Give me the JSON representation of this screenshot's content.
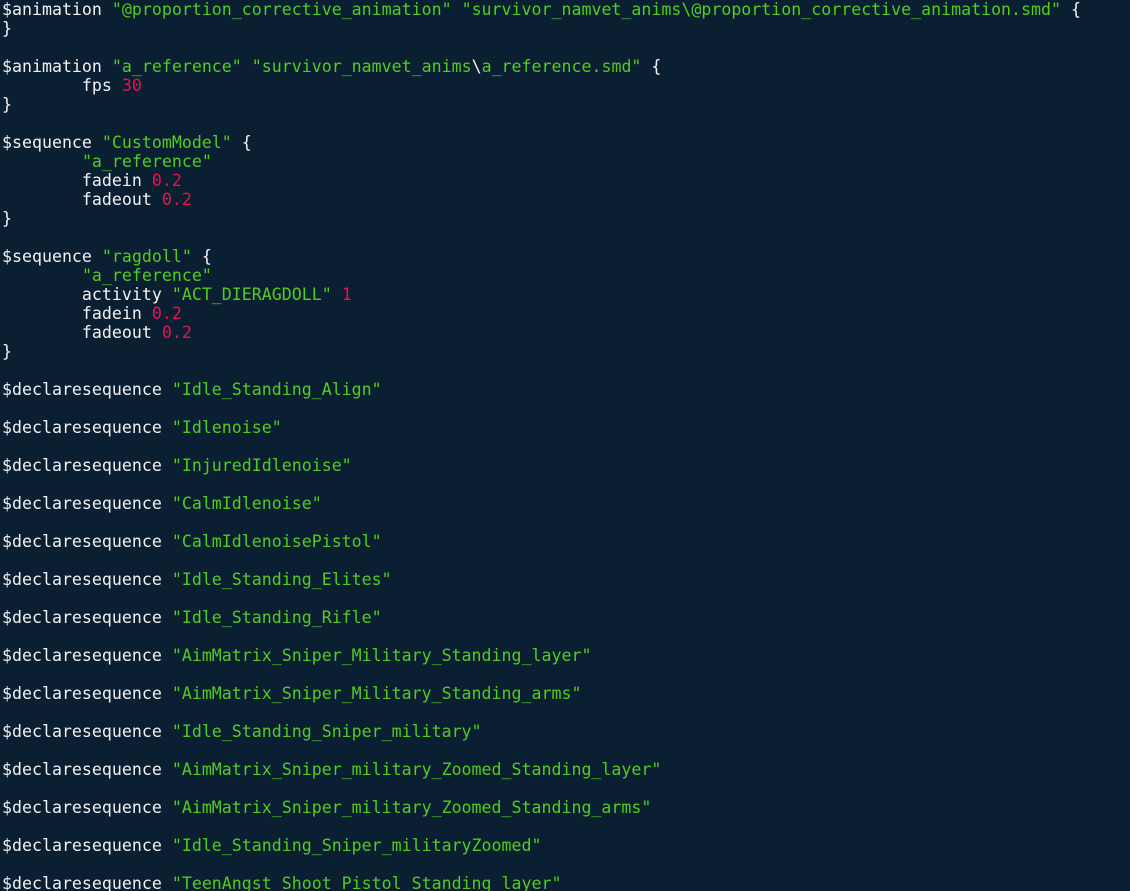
{
  "colors": {
    "background": "#0b1f33",
    "text": "#f2f2f2",
    "string": "#52cc1e",
    "number": "#e8124f"
  },
  "lines": [
    [
      {
        "t": "kw",
        "v": "$animation "
      },
      {
        "t": "str",
        "v": "\"@proportion_corrective_animation\""
      },
      {
        "t": "kw",
        "v": " "
      },
      {
        "t": "str",
        "v": "\"survivor_namvet_anims\\@proportion_corrective_animation.smd\""
      },
      {
        "t": "punc",
        "v": " {"
      }
    ],
    [
      {
        "t": "punc",
        "v": "}"
      }
    ],
    [],
    [
      {
        "t": "kw",
        "v": "$animation "
      },
      {
        "t": "str",
        "v": "\"a_reference\""
      },
      {
        "t": "kw",
        "v": " "
      },
      {
        "t": "str",
        "v": "\"survivor_namvet_anims"
      },
      {
        "t": "kw",
        "v": "\\"
      },
      {
        "t": "str",
        "v": "a_reference.smd\""
      },
      {
        "t": "punc",
        "v": " {"
      }
    ],
    [
      {
        "t": "kw",
        "v": "        fps "
      },
      {
        "t": "num",
        "v": "30"
      }
    ],
    [
      {
        "t": "punc",
        "v": "}"
      }
    ],
    [],
    [
      {
        "t": "kw",
        "v": "$sequence "
      },
      {
        "t": "str",
        "v": "\"CustomModel\""
      },
      {
        "t": "punc",
        "v": " {"
      }
    ],
    [
      {
        "t": "kw",
        "v": "        "
      },
      {
        "t": "str",
        "v": "\"a_reference\""
      }
    ],
    [
      {
        "t": "kw",
        "v": "        fadein "
      },
      {
        "t": "num",
        "v": "0.2"
      }
    ],
    [
      {
        "t": "kw",
        "v": "        fadeout "
      },
      {
        "t": "num",
        "v": "0.2"
      }
    ],
    [
      {
        "t": "punc",
        "v": "}"
      }
    ],
    [],
    [
      {
        "t": "kw",
        "v": "$sequence "
      },
      {
        "t": "str",
        "v": "\"ragdoll\""
      },
      {
        "t": "punc",
        "v": " {"
      }
    ],
    [
      {
        "t": "kw",
        "v": "        "
      },
      {
        "t": "str",
        "v": "\"a_reference\""
      }
    ],
    [
      {
        "t": "kw",
        "v": "        activity "
      },
      {
        "t": "str",
        "v": "\"ACT_DIERAGDOLL\""
      },
      {
        "t": "kw",
        "v": " "
      },
      {
        "t": "num",
        "v": "1"
      }
    ],
    [
      {
        "t": "kw",
        "v": "        fadein "
      },
      {
        "t": "num",
        "v": "0.2"
      }
    ],
    [
      {
        "t": "kw",
        "v": "        fadeout "
      },
      {
        "t": "num",
        "v": "0.2"
      }
    ],
    [
      {
        "t": "punc",
        "v": "}"
      }
    ],
    [],
    [
      {
        "t": "kw",
        "v": "$declaresequence "
      },
      {
        "t": "str",
        "v": "\"Idle_Standing_Align\""
      }
    ],
    [],
    [
      {
        "t": "kw",
        "v": "$declaresequence "
      },
      {
        "t": "str",
        "v": "\"Idlenoise\""
      }
    ],
    [],
    [
      {
        "t": "kw",
        "v": "$declaresequence "
      },
      {
        "t": "str",
        "v": "\"InjuredIdlenoise\""
      }
    ],
    [],
    [
      {
        "t": "kw",
        "v": "$declaresequence "
      },
      {
        "t": "str",
        "v": "\"CalmIdlenoise\""
      }
    ],
    [],
    [
      {
        "t": "kw",
        "v": "$declaresequence "
      },
      {
        "t": "str",
        "v": "\"CalmIdlenoisePistol\""
      }
    ],
    [],
    [
      {
        "t": "kw",
        "v": "$declaresequence "
      },
      {
        "t": "str",
        "v": "\"Idle_Standing_Elites\""
      }
    ],
    [],
    [
      {
        "t": "kw",
        "v": "$declaresequence "
      },
      {
        "t": "str",
        "v": "\"Idle_Standing_Rifle\""
      }
    ],
    [],
    [
      {
        "t": "kw",
        "v": "$declaresequence "
      },
      {
        "t": "str",
        "v": "\"AimMatrix_Sniper_Military_Standing_layer\""
      }
    ],
    [],
    [
      {
        "t": "kw",
        "v": "$declaresequence "
      },
      {
        "t": "str",
        "v": "\"AimMatrix_Sniper_Military_Standing_arms\""
      }
    ],
    [],
    [
      {
        "t": "kw",
        "v": "$declaresequence "
      },
      {
        "t": "str",
        "v": "\"Idle_Standing_Sniper_military\""
      }
    ],
    [],
    [
      {
        "t": "kw",
        "v": "$declaresequence "
      },
      {
        "t": "str",
        "v": "\"AimMatrix_Sniper_military_Zoomed_Standing_layer\""
      }
    ],
    [],
    [
      {
        "t": "kw",
        "v": "$declaresequence "
      },
      {
        "t": "str",
        "v": "\"AimMatrix_Sniper_military_Zoomed_Standing_arms\""
      }
    ],
    [],
    [
      {
        "t": "kw",
        "v": "$declaresequence "
      },
      {
        "t": "str",
        "v": "\"Idle_Standing_Sniper_militaryZoomed\""
      }
    ],
    [],
    [
      {
        "t": "kw",
        "v": "$declaresequence "
      },
      {
        "t": "str",
        "v": "\"TeenAngst_Shoot_Pistol_Standing_layer\""
      }
    ]
  ]
}
